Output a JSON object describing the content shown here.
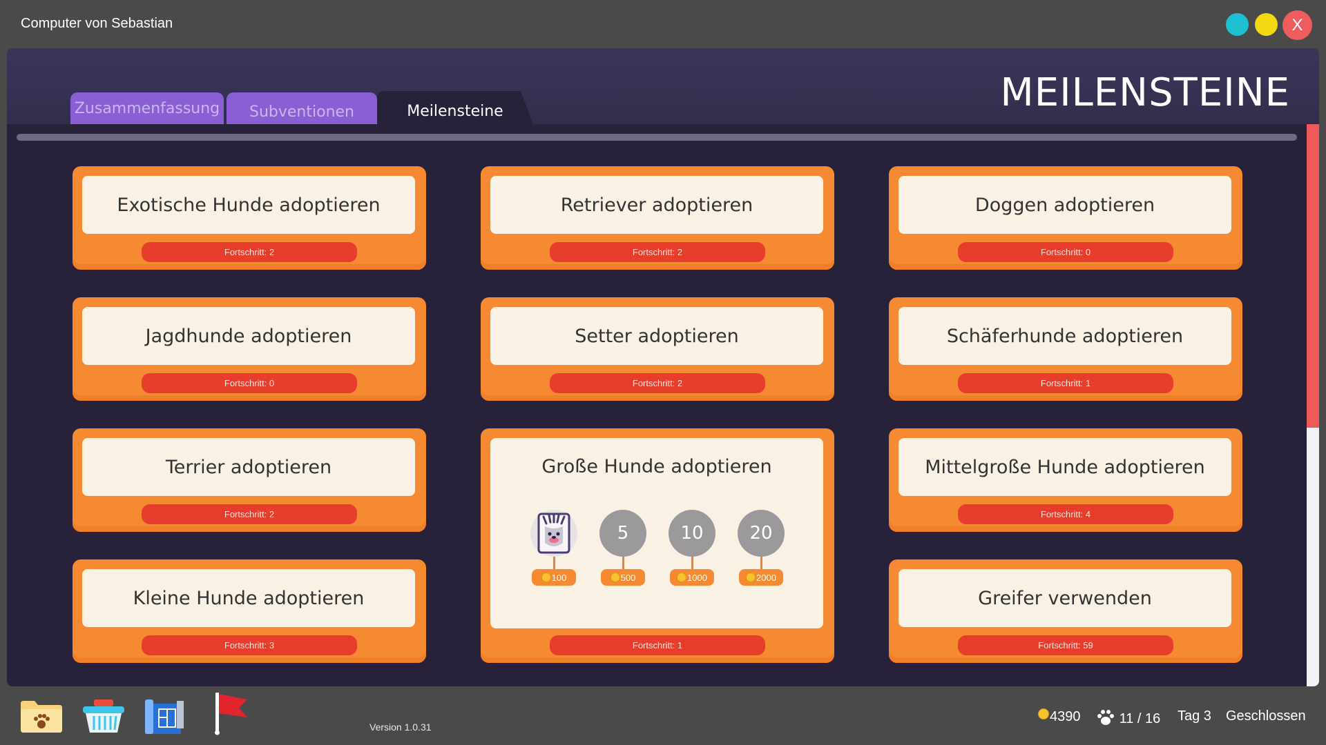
{
  "window": {
    "title": "Computer von Sebastian",
    "close_label": "X"
  },
  "header": {
    "title": "MEILENSTEINE"
  },
  "tabs": [
    {
      "label": "Zusammenfassung",
      "active": false
    },
    {
      "label": "Subventionen",
      "active": false
    },
    {
      "label": "Meilensteine",
      "active": true
    }
  ],
  "milestones": [
    {
      "label": "Exotische Hunde adoptieren",
      "progress": "Fortschritt: 2"
    },
    {
      "label": "Retriever adoptieren",
      "progress": "Fortschritt: 2"
    },
    {
      "label": "Doggen adoptieren",
      "progress": "Fortschritt: 0"
    },
    {
      "label": "Jagdhunde adoptieren",
      "progress": "Fortschritt: 0"
    },
    {
      "label": "Setter adoptieren",
      "progress": "Fortschritt: 2"
    },
    {
      "label": "Schäferhunde adoptieren",
      "progress": "Fortschritt: 1"
    },
    {
      "label": "Terrier adoptieren",
      "progress": "Fortschritt: 2"
    },
    {
      "label": "Große Hunde adoptieren",
      "progress": "Fortschritt: 1",
      "tiers": [
        {
          "goal": "",
          "reward": "100",
          "achieved": true
        },
        {
          "goal": "5",
          "reward": "500",
          "achieved": false
        },
        {
          "goal": "10",
          "reward": "1000",
          "achieved": false
        },
        {
          "goal": "20",
          "reward": "2000",
          "achieved": false
        }
      ]
    },
    {
      "label": "Mittelgroße Hunde adoptieren",
      "progress": "Fortschritt: 4"
    },
    {
      "label": "Kleine Hunde adoptieren",
      "progress": "Fortschritt: 3"
    },
    {
      "label": "Greifer verwenden",
      "progress": "Fortschritt: 59"
    }
  ],
  "taskbar": {
    "icons": [
      "folder-paw-icon",
      "basket-icon",
      "blueprint-icon",
      "flag-icon"
    ],
    "version": "Version 1.0.31"
  },
  "status": {
    "coins": "4390",
    "dogs": "11 / 16",
    "day": "Tag 3",
    "state": "Geschlossen"
  },
  "colors": {
    "card_orange": "#f58a32",
    "progress_red": "#e73d2d",
    "tab_purple": "#8a5fd4",
    "window_bg": "#27223a"
  }
}
